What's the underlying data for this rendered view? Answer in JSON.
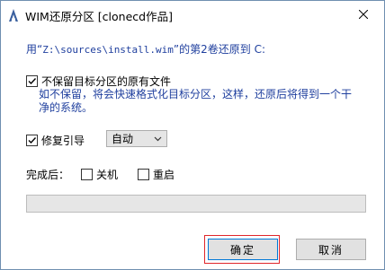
{
  "window": {
    "title": "WIM还原分区 [clonecd作品]",
    "close_icon": "close-icon",
    "app_icon": "app-icon"
  },
  "message": {
    "prefix": "用“",
    "path": "Z:\\sources\\install.wim",
    "suffix": "”的第2卷还原到 C:"
  },
  "options": {
    "keep_files_label": "不保留目标分区的原有文件",
    "keep_files_checked": true,
    "keep_files_note": "如不保留，将会快速格式化目标分区，这样，还原后将得到一个干净的系统。",
    "repair_boot_label": "修复引导",
    "repair_boot_checked": true,
    "repair_boot_mode": "自动"
  },
  "after": {
    "label": "完成后：",
    "shutdown_label": "关机",
    "shutdown_checked": false,
    "restart_label": "重启",
    "restart_checked": false
  },
  "progress": {
    "value": 0
  },
  "buttons": {
    "ok_label": "确定",
    "cancel_label": "取消"
  },
  "colors": {
    "accent_text": "#1f3f9e",
    "ok_highlight": "#e0262b",
    "focus_border": "#0078d7"
  }
}
